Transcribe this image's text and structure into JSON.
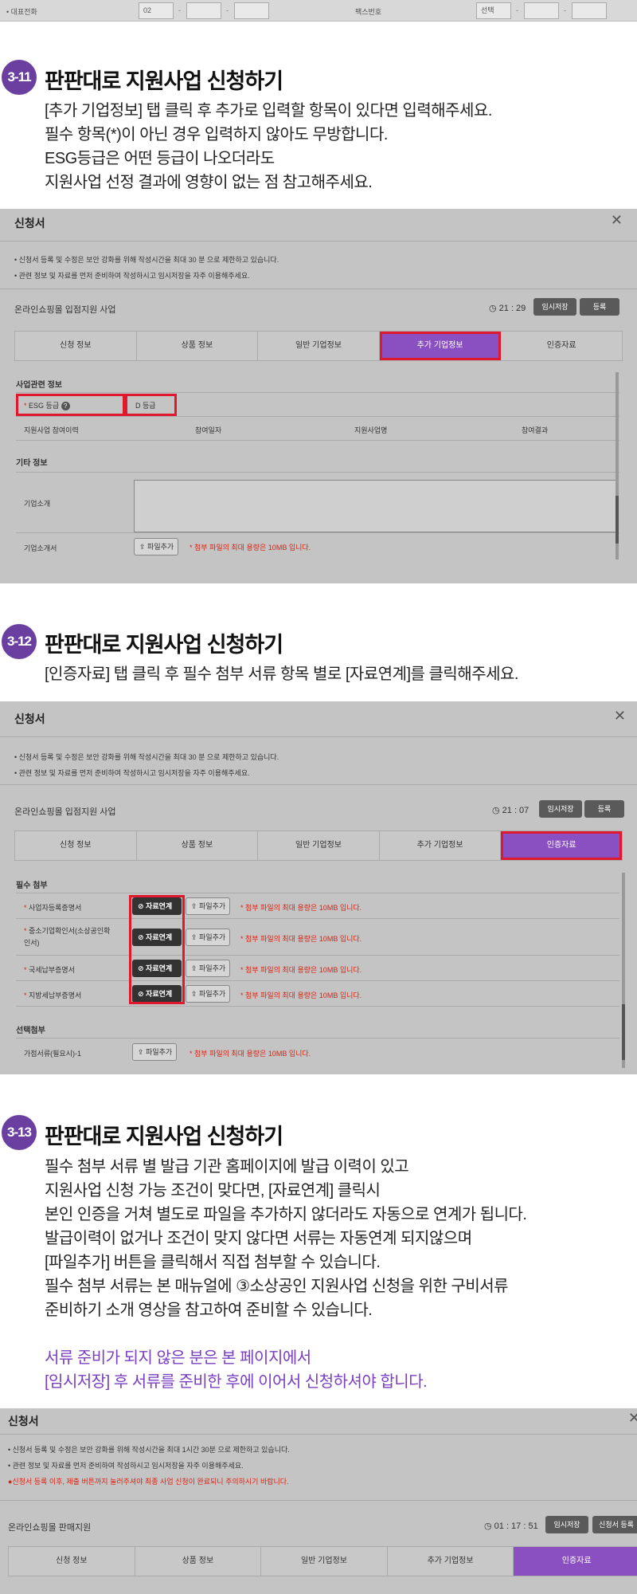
{
  "top_strip": {
    "phone_label": "• 대표전화",
    "phone_prefix": "02",
    "fax_label": "팩스번호",
    "fax_select": "선택"
  },
  "step_3_11": {
    "badge": "3-11",
    "title": "판판대로 지원사업 신청하기",
    "lines": [
      "[추가 기업정보] 탭 클릭 후 추가로 입력할 항목이 있다면 입력해주세요.",
      "필수 항목(*)이 아닌 경우 입력하지 않아도 무방합니다.",
      "ESG등급은 어떤 등급이 나오더라도",
      "지원사업 선정 결과에 영향이 없는 점 참고해주세요."
    ]
  },
  "dialog1": {
    "title": "신청서",
    "notices": [
      "• 신청서 등록 및 수정은 보안 강화를 위해 작성시간을 최대 30 분 으로 제한하고 있습니다.",
      "• 관련 정보 및 자료를 먼저 준비하여 작성하시고 임시저장을 자주 이용해주세요."
    ],
    "program": "온라인쇼핑몰 입점지원 사업",
    "timer": "21 : 29",
    "save_label": "임시저장",
    "register_label": "등록",
    "tabs": [
      "신청 정보",
      "상품 정보",
      "일반 기업정보",
      "추가 기업정보",
      "인증자료"
    ],
    "section1": "사업관련 정보",
    "esg_label": "ESG 등급",
    "esg_value": "D 등급",
    "history_label": "지원사업 참여이력",
    "history_cols": [
      "참여일자",
      "지원사업명",
      "참여결과"
    ],
    "section2": "기타 정보",
    "intro_label": "기업소개",
    "intro_doc_label": "기업소개서",
    "file_add": "파일추가",
    "file_note": "* 첨부 파일의 최대 용량은 10MB 입니다."
  },
  "step_3_12": {
    "badge": "3-12",
    "title": "판판대로 지원사업 신청하기",
    "lines": [
      "[인증자료] 탭 클릭 후 필수 첨부 서류 항목 별로 [자료연계]를 클릭해주세요."
    ]
  },
  "dialog2": {
    "title": "신청서",
    "notices": [
      "• 신청서 등록 및 수정은 보안 강화를 위해 작성시간을 최대 30 분 으로 제한하고 있습니다.",
      "• 관련 정보 및 자료를 먼저 준비하여 작성하시고 임시저장을 자주 이용해주세요."
    ],
    "program": "온라인쇼핑몰 입점지원 사업",
    "timer": "21 : 07",
    "save_label": "임시저장",
    "register_label": "등록",
    "tabs": [
      "신청 정보",
      "상품 정보",
      "일반 기업정보",
      "추가 기업정보",
      "인증자료"
    ],
    "required_section": "필수 첨부",
    "docs": [
      {
        "label": "사업자등록증명서"
      },
      {
        "label": "중소기업확인서(소상공인확인서)"
      },
      {
        "label": "국세납부증명서"
      },
      {
        "label": "지방세납부증명서"
      }
    ],
    "link_label": "자료연계",
    "file_add": "파일추가",
    "file_note": "* 첨부 파일의 최대 용량은 10MB 입니다.",
    "optional_section": "선택첨부",
    "optional_doc": "가점서류(필요시)-1"
  },
  "step_3_13": {
    "badge": "3-13",
    "title": "판판대로 지원사업 신청하기",
    "lines": [
      "필수 첨부 서류 별 발급 기관 홈페이지에 발급 이력이 있고",
      "지원사업 신청 가능 조건이 맞다면, [자료연계] 클릭시",
      "본인 인증을 거쳐 별도로 파일을 추가하지 않더라도 자동으로 연계가 됩니다.",
      "발급이력이 없거나 조건이 맞지 않다면 서류는 자동연계 되지않으며",
      "[파일추가] 버튼을 클릭해서 직접 첨부할 수 있습니다.",
      "필수 첨부 서류는 본 매뉴얼에 ③소상공인 지원사업 신청을 위한 구비서류",
      "준비하기 소개 영상을 참고하여 준비할 수 있습니다."
    ],
    "highlight_lines": [
      "서류 준비가 되지 않은 분은 본 페이지에서",
      "[임시저장] 후 서류를 준비한 후에 이어서 신청하셔야 합니다."
    ]
  },
  "dialog3": {
    "title": "신청서",
    "notices": [
      "• 신청서 등록 및 수정은 보안 강화를 위해 작성시간을 최대 1시간 30분 으로 제한하고 있습니다.",
      "• 관련 정보 및 자료를 먼저 준비하여 작성하시고 임시저장을 자주 이용해주세요.",
      "●신청서 등록 이후, 제출 버튼까지 눌러주셔야 최종 사업 신청이 완료되니 주의하시기 바랍니다."
    ],
    "program": "온라인쇼핑몰 판매지원",
    "timer": "01 : 17 : 51",
    "save_label": "임시저장",
    "register_label": "신청서 등록",
    "tabs": [
      "신청 정보",
      "상품 정보",
      "일반 기업정보",
      "추가 기업정보",
      "인증자료"
    ]
  }
}
